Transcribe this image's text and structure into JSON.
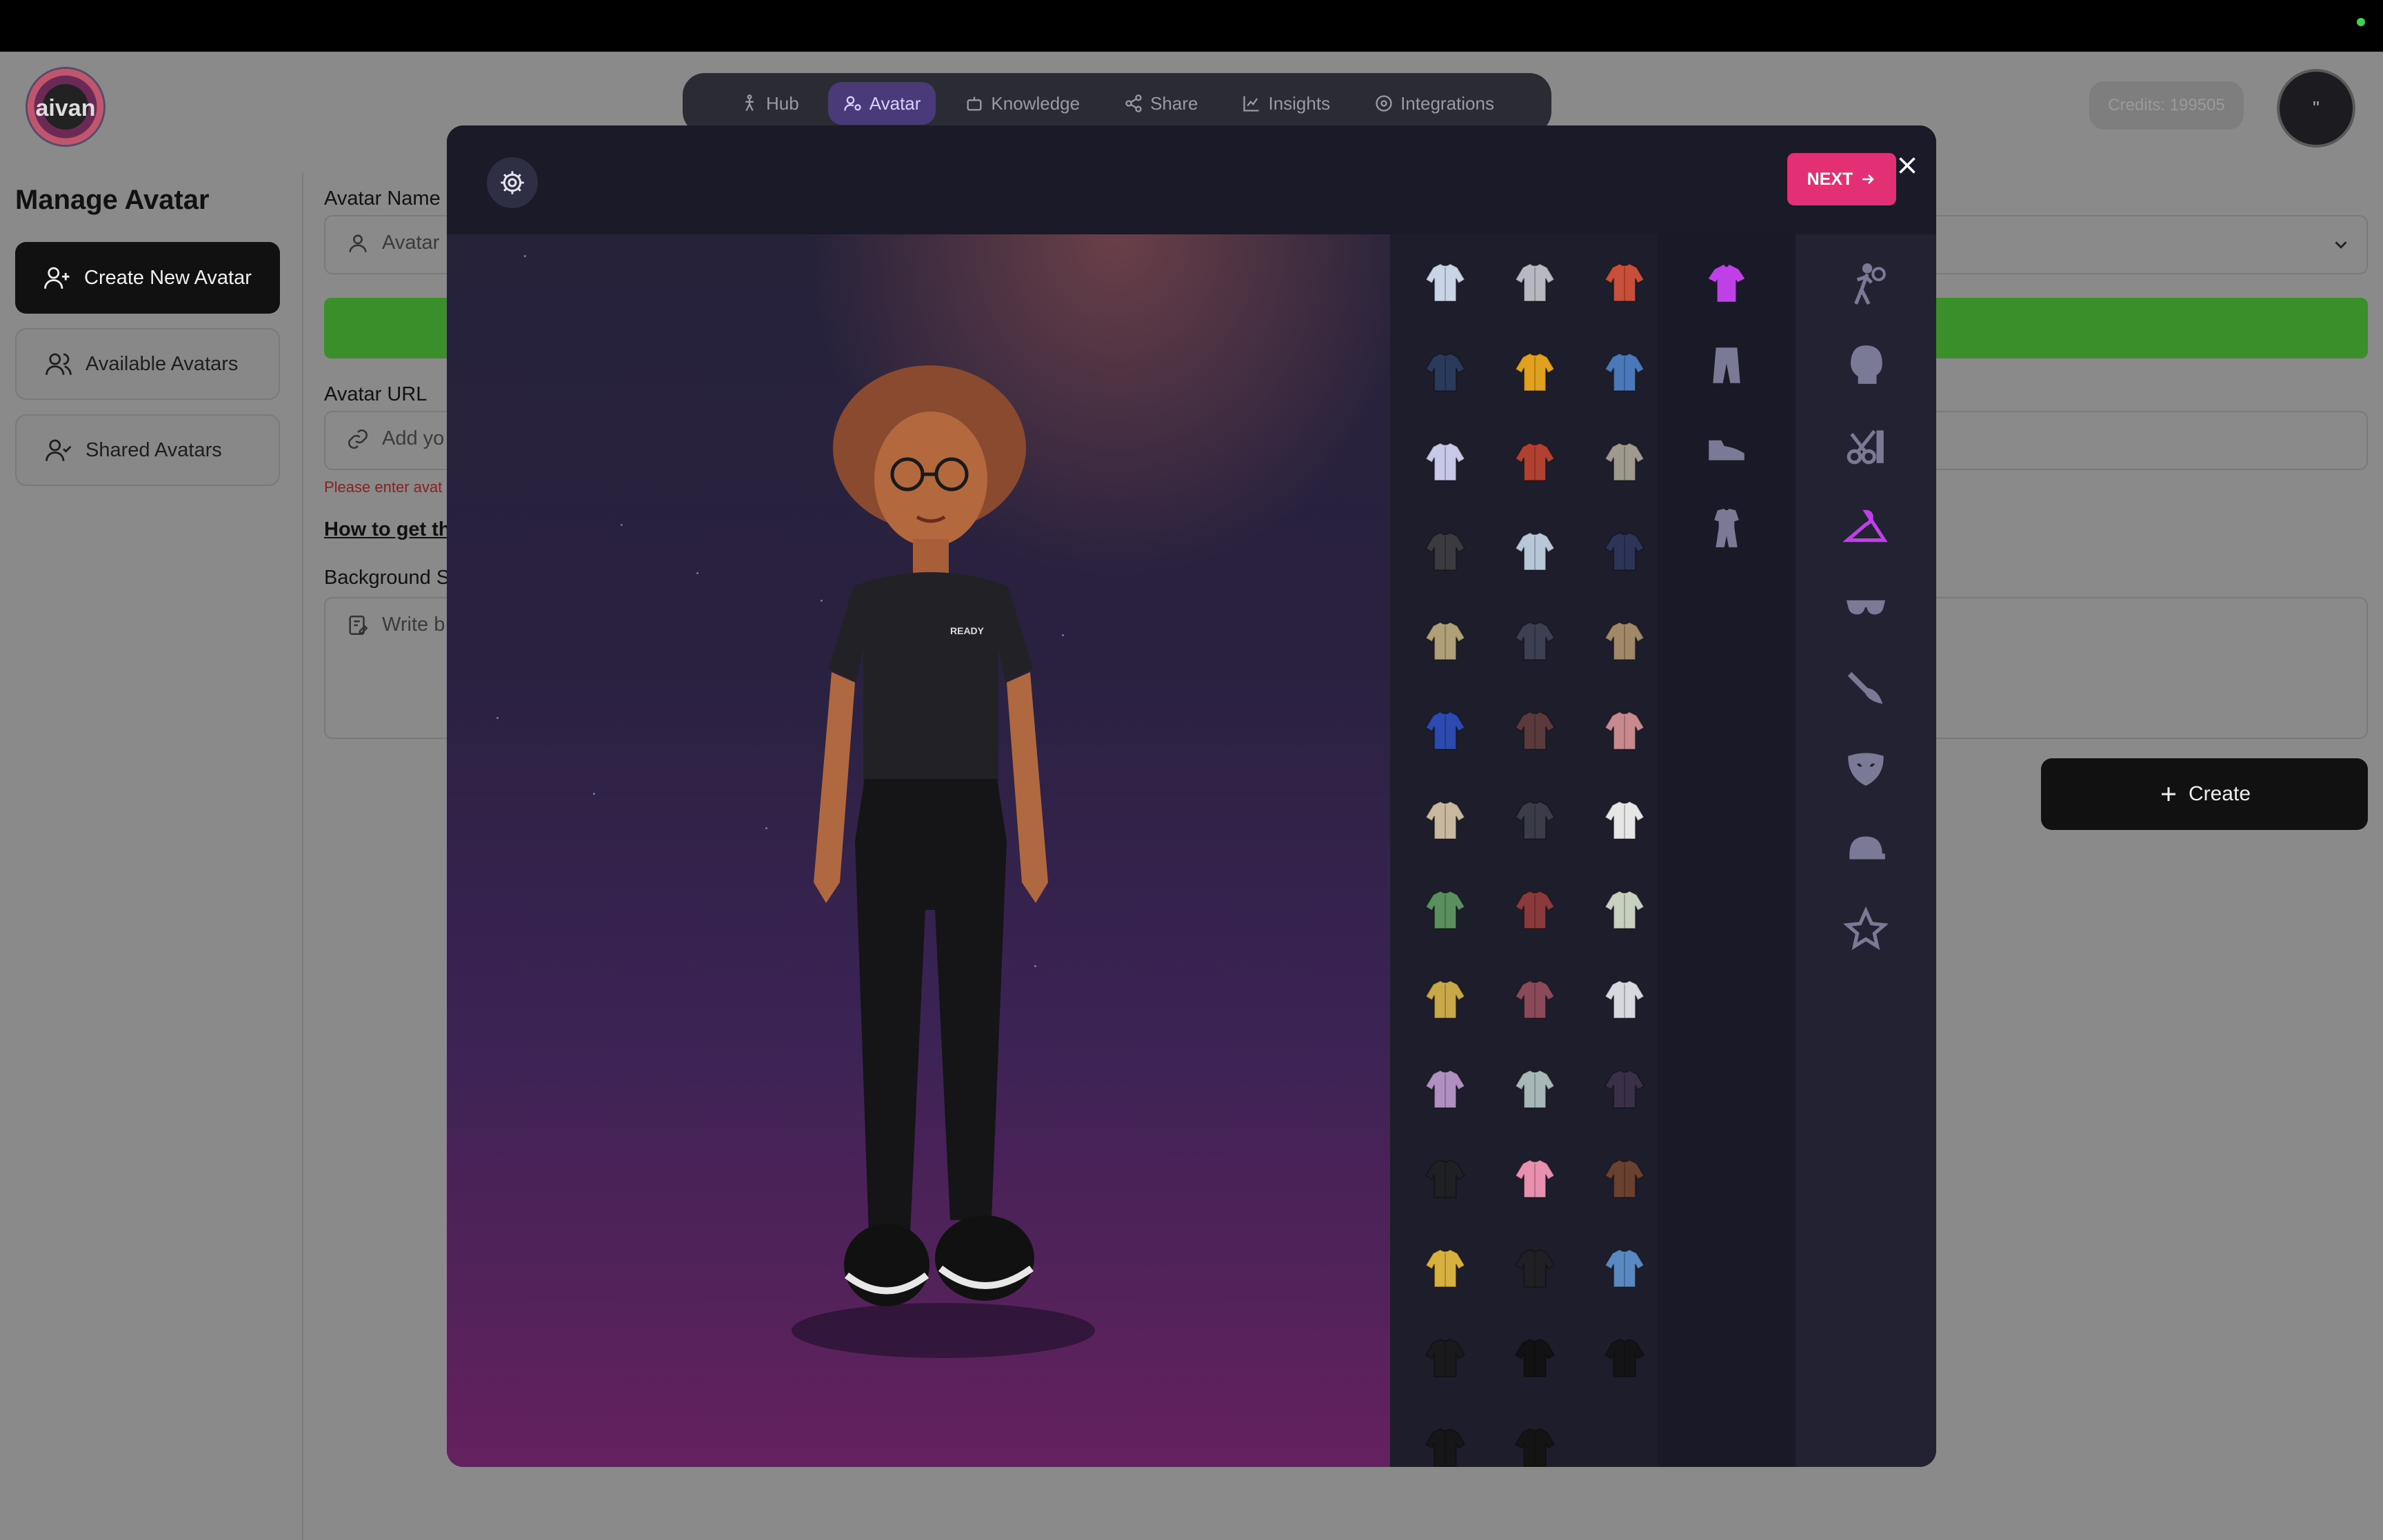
{
  "app": {
    "logo_text": "aivan",
    "credits": "Credits: 199505",
    "profile_initial": "\""
  },
  "nav": {
    "items": [
      {
        "label": "Hub",
        "icon": "figure-icon"
      },
      {
        "label": "Avatar",
        "icon": "user-gear-icon",
        "active": true
      },
      {
        "label": "Knowledge",
        "icon": "robot-icon"
      },
      {
        "label": "Share",
        "icon": "share-icon"
      },
      {
        "label": "Insights",
        "icon": "chart-line-icon"
      },
      {
        "label": "Integrations",
        "icon": "gear-icon"
      }
    ]
  },
  "sidebar": {
    "title": "Manage Avatar",
    "buttons": [
      {
        "label": "Create New Avatar",
        "icon": "user-plus-icon"
      },
      {
        "label": "Available Avatars",
        "icon": "users-icon"
      },
      {
        "label": "Shared Avatars",
        "icon": "user-check-icon"
      }
    ]
  },
  "form": {
    "avatar_name_label": "Avatar Name",
    "avatar_name_placeholder": "Avatar",
    "avatar_url_label": "Avatar URL",
    "avatar_url_placeholder": "Add yo",
    "error_text": "Please enter avat",
    "how_to_link": "How to get the",
    "background_label": "Background S",
    "background_placeholder": "Write b",
    "create_label": "Create"
  },
  "modal": {
    "next_label": "NEXT",
    "items_colors": [
      "#c9d4e6",
      "#b8b8c0",
      "#c8503a",
      "#2a3a5a",
      "#e0a020",
      "#4a78b8",
      "#c8c8e8",
      "#b04030",
      "#a09a8e",
      "#3a3a40",
      "#b8c8d8",
      "#2e3458",
      "#b0a078",
      "#3c4052",
      "#a08868",
      "#2c4ab0",
      "#5a3a3c",
      "#c88a8e",
      "#c8b8a0",
      "#3a3d48",
      "#e6e6e6",
      "#5a9060",
      "#8a3a3a",
      "#c8d0c0",
      "#c8a848",
      "#8a4a5a",
      "#d8d8e0",
      "#b090c0",
      "#a8b8b8",
      "#3a3048",
      "#1e2024",
      "#e890b0",
      "#6a4030",
      "#d8b040",
      "#202024",
      "#5a88c0",
      "#1a1a1c",
      "#121214",
      "#141416",
      "#161618",
      "#141414"
    ],
    "subcategories": [
      {
        "name": "tshirt-icon",
        "active": true
      },
      {
        "name": "pants-icon",
        "active": false
      },
      {
        "name": "shoe-icon",
        "active": false
      },
      {
        "name": "outfit-icon",
        "active": false
      }
    ],
    "categories": [
      {
        "name": "body-pose-icon",
        "active": false
      },
      {
        "name": "head-icon",
        "active": false
      },
      {
        "name": "hair-scissors-icon",
        "active": false
      },
      {
        "name": "hanger-icon",
        "active": true
      },
      {
        "name": "glasses-icon",
        "active": false
      },
      {
        "name": "makeup-brush-icon",
        "active": false
      },
      {
        "name": "mask-icon",
        "active": false
      },
      {
        "name": "cap-icon",
        "active": false
      },
      {
        "name": "star-icon",
        "active": false
      }
    ],
    "active_color": "#c040e8",
    "inactive_color": "#7a7a96"
  }
}
